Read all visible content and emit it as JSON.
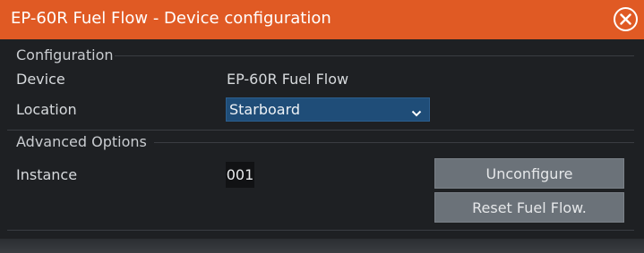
{
  "dialog": {
    "title": "EP-60R Fuel Flow - Device configuration",
    "close_icon": "close-circle-icon",
    "accent_color": "#e05a24"
  },
  "configuration": {
    "header": "Configuration",
    "device_label": "Device",
    "device_value": "EP-60R Fuel Flow",
    "location_label": "Location",
    "location_selected": "Starboard",
    "location_chevron_icon": "chevron-down-icon",
    "select_color": "#1f4d78"
  },
  "advanced": {
    "header": "Advanced Options",
    "instance_label": "Instance",
    "instance_value": "001",
    "unconfigure_label": "Unconfigure",
    "reset_label": "Reset Fuel Flow."
  }
}
